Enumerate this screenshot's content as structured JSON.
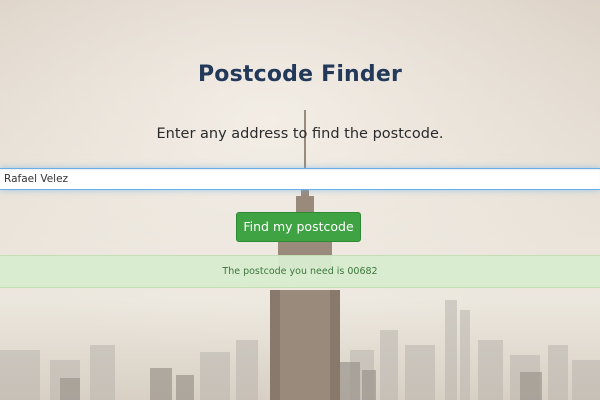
{
  "page": {
    "title": "Postcode Finder",
    "subtitle": "Enter any address to find the postcode."
  },
  "form": {
    "address_value": "Rafael Velez",
    "button_label": "Find my postcode"
  },
  "result": {
    "message": "The postcode you need is 00682"
  },
  "colors": {
    "title": "#22395a",
    "button": "#3fa243",
    "alert_background": "#d7eccf",
    "alert_text": "#3c763d",
    "input_focus_border": "#66afe9"
  },
  "background": {
    "description_icon": "city-skyline-background"
  }
}
